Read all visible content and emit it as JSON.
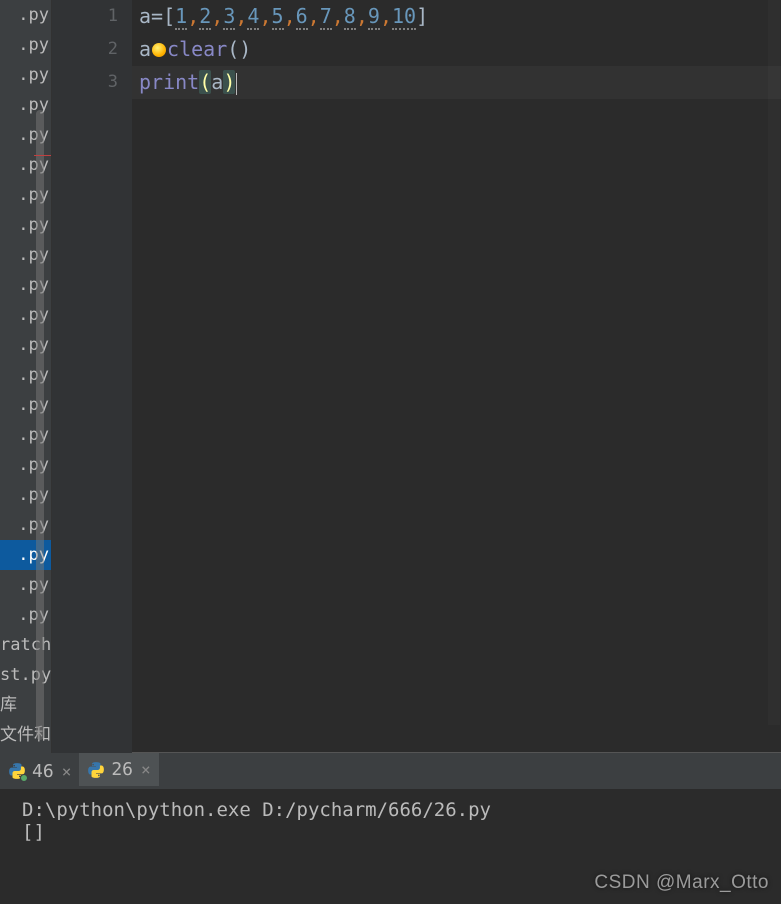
{
  "sidebar": {
    "files": [
      ".py",
      ".py",
      ".py",
      ".py",
      ".py",
      ".py",
      ".py",
      ".py",
      ".py",
      ".py",
      ".py",
      ".py",
      ".py",
      ".py",
      ".py",
      ".py",
      ".py",
      ".py",
      ".py",
      ".py",
      ".py",
      "ratch.p",
      "st.py",
      "库",
      "文件和"
    ],
    "selected_index": 18
  },
  "editor": {
    "gutter": [
      "1",
      "2",
      "3"
    ],
    "code": {
      "l1": {
        "var": "a",
        "eq": "=",
        "lb": "[",
        "nums": [
          "1",
          "2",
          "3",
          "4",
          "5",
          "6",
          "7",
          "8",
          "9",
          "10"
        ],
        "comma": ",",
        "rb": "]"
      },
      "l2": {
        "var": "a",
        "dot": ".",
        "method": "clear",
        "paren": "()"
      },
      "l3": {
        "fn": "print",
        "lp": "(",
        "arg": "a",
        "rp": ")"
      }
    }
  },
  "run_tabs": {
    "tabs": [
      {
        "label": "46",
        "active": false,
        "has_green_dot": true
      },
      {
        "label": "26",
        "active": true,
        "has_green_dot": false
      }
    ],
    "close_glyph": "×"
  },
  "console": {
    "line1": "D:\\python\\python.exe D:/pycharm/666/26.py",
    "line2": "[]"
  },
  "watermark": "CSDN @Marx_Otto"
}
